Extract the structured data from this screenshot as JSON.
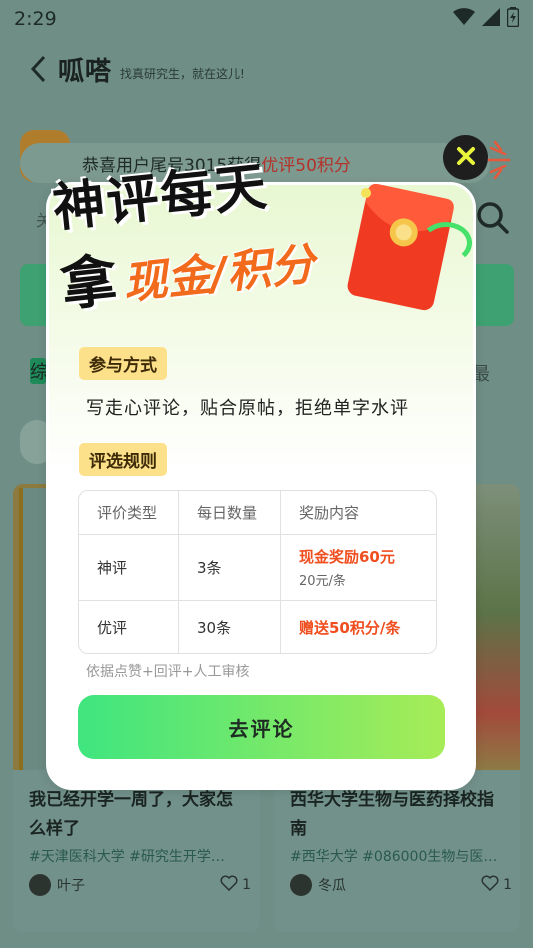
{
  "status_bar": {
    "time": "2:29"
  },
  "header": {
    "logo": "呱嗒",
    "slogan": "找真研究生，就在这儿!"
  },
  "notice": {
    "prefix": "恭喜用户尾号3015获得",
    "highlight": "优评50积分"
  },
  "search": {
    "placeholder": "关"
  },
  "tabs": {
    "first": "综",
    "last": "最"
  },
  "cards": [
    {
      "title": "我已经开学一周了，大家怎么样了",
      "tags": "#天津医科大学 #研究生开学…",
      "author": "叶子",
      "likes": "1"
    },
    {
      "title": "西华大学生物与医药择校指南",
      "tags": "#西华大学 #086000生物与医…",
      "author": "冬瓜",
      "likes": "1"
    }
  ],
  "modal": {
    "title_line1": "神评每天",
    "title_line2_mark": "拿",
    "title_line2_reward": "现金/积分",
    "join_label": "参与方式",
    "join_text": "写走心评论，贴合原帖，拒绝单字水评",
    "rule_label": "评选规则",
    "table": {
      "headers": [
        "评价类型",
        "每日数量",
        "奖励内容"
      ],
      "rows": [
        {
          "type": "神评",
          "count": "3条",
          "reward": "现金奖励60元",
          "reward_sub": "20元/条"
        },
        {
          "type": "优评",
          "count": "30条",
          "reward": "赠送50积分/条",
          "reward_sub": ""
        }
      ]
    },
    "note": "依据点赞+回评+人工审核",
    "button": "去评论"
  },
  "colors": {
    "accent_orange": "#f04e1e",
    "button_green": "#3fe57f",
    "label_yellow": "#fde08a",
    "overlay": "#6f8e86"
  },
  "icons": [
    "back-icon",
    "search-icon",
    "close-icon",
    "heart-icon",
    "wifi-icon",
    "signal-icon",
    "battery-icon",
    "red-envelope-icon"
  ]
}
